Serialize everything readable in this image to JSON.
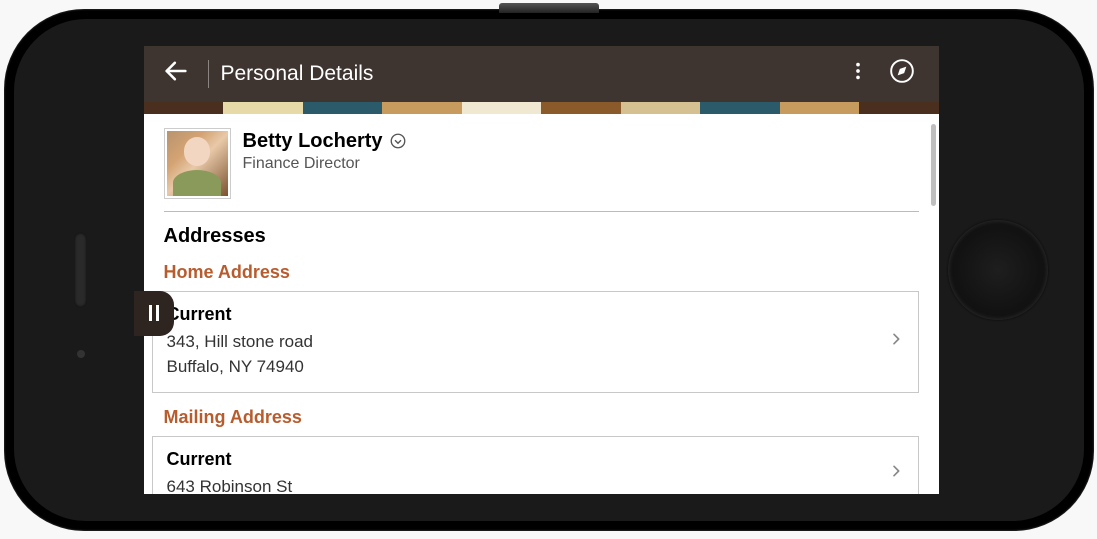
{
  "header": {
    "title": "Personal Details"
  },
  "person": {
    "name": "Betty Locherty",
    "job_title": "Finance Director"
  },
  "sections": {
    "addresses_title": "Addresses",
    "home": {
      "heading": "Home Address",
      "status": "Current",
      "line1": "343, Hill stone road",
      "line2": "Buffalo, NY 74940"
    },
    "mailing": {
      "heading": "Mailing Address",
      "status": "Current",
      "line1": "643 Robinson St"
    }
  }
}
